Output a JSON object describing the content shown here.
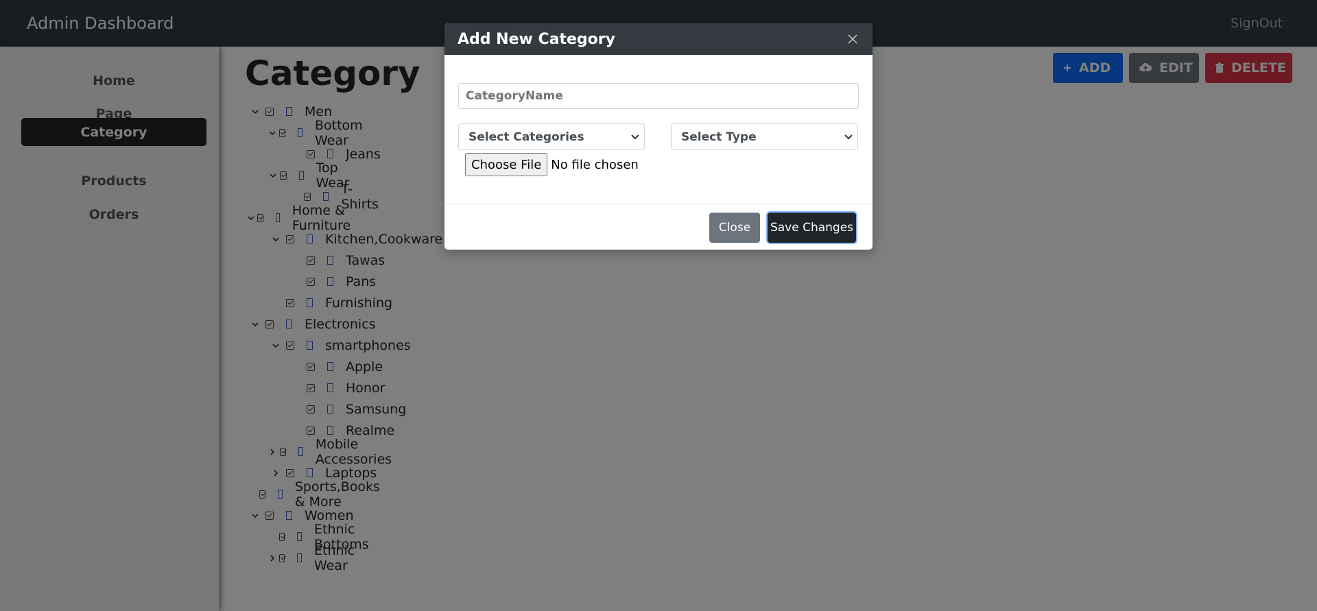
{
  "navbar": {
    "brand": "Admin Dashboard",
    "signout": "SignOut"
  },
  "sidebar": {
    "items": [
      {
        "label": "Home",
        "active": false
      },
      {
        "label": "Page",
        "active": false
      },
      {
        "label": "Category",
        "active": true
      },
      {
        "label": "Products",
        "active": false
      },
      {
        "label": "Orders",
        "active": false
      }
    ]
  },
  "main": {
    "title": "Category",
    "actions": {
      "add": "ADD",
      "edit": "EDIT",
      "delete": "DELETE"
    }
  },
  "tree": [
    {
      "label": "Men",
      "level": 0,
      "toggle": "expanded"
    },
    {
      "label": "Bottom Wear",
      "level": 1,
      "toggle": "expanded"
    },
    {
      "label": "Jeans",
      "level": 2,
      "toggle": "none"
    },
    {
      "label": "Top Wear",
      "level": 1,
      "toggle": "expanded"
    },
    {
      "label": "T-Shirts",
      "level": 2,
      "toggle": "none"
    },
    {
      "label": "Home & Furniture",
      "level": 0,
      "toggle": "expanded"
    },
    {
      "label": "Kitchen,Cookware",
      "level": 1,
      "toggle": "expanded"
    },
    {
      "label": "Tawas",
      "level": 2,
      "toggle": "none"
    },
    {
      "label": "Pans",
      "level": 2,
      "toggle": "none"
    },
    {
      "label": "Furnishing",
      "level": 1,
      "toggle": "none"
    },
    {
      "label": "Electronics",
      "level": 0,
      "toggle": "expanded"
    },
    {
      "label": "smartphones",
      "level": 1,
      "toggle": "expanded"
    },
    {
      "label": "Apple",
      "level": 2,
      "toggle": "none"
    },
    {
      "label": "Honor",
      "level": 2,
      "toggle": "none"
    },
    {
      "label": "Samsung",
      "level": 2,
      "toggle": "none"
    },
    {
      "label": "Realme",
      "level": 2,
      "toggle": "none"
    },
    {
      "label": "Mobile Accessories",
      "level": 1,
      "toggle": "collapsed"
    },
    {
      "label": "Laptops",
      "level": 1,
      "toggle": "collapsed"
    },
    {
      "label": "Sports,Books & More",
      "level": 0,
      "toggle": "none"
    },
    {
      "label": "Women",
      "level": 0,
      "toggle": "expanded"
    },
    {
      "label": "Ethnic Bottoms",
      "level": 1,
      "toggle": "none"
    },
    {
      "label": "Ethnic Wear",
      "level": 1,
      "toggle": "collapsed"
    }
  ],
  "modal": {
    "title": "Add New Category",
    "name_placeholder": "CategoryName",
    "select_categories": "Select Categories",
    "select_type": "Select Type",
    "choose_file": "Choose File",
    "no_file": "No file chosen",
    "close": "Close",
    "save": "Save Changes"
  },
  "colors": {
    "navbar_bg": "#343a40",
    "add": "#0d6efd",
    "edit": "#6c757d",
    "delete": "#dc3545",
    "active_nav": "#212529",
    "backdrop": "rgba(0,0,0,0.5)"
  }
}
